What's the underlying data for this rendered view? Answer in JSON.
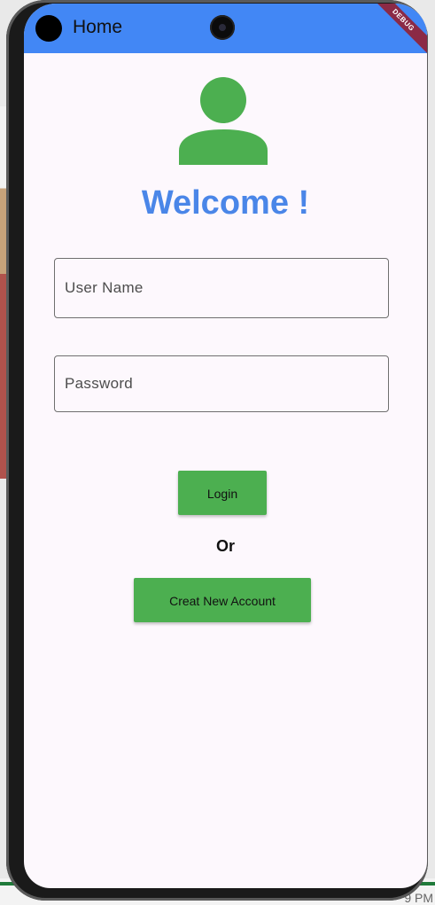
{
  "appbar": {
    "title": "Home",
    "debug_banner": "DEBUG"
  },
  "welcome": "Welcome !",
  "form": {
    "username_placeholder": "User Name",
    "password_placeholder": "Password"
  },
  "buttons": {
    "login": "Login",
    "or": "Or",
    "create_account": "Creat New Account"
  },
  "taskbar_clock": "9 PM",
  "colors": {
    "appbar": "#4287f5",
    "accent_green": "#4caf50",
    "welcome_text": "#4a86e8"
  },
  "icons": {
    "profile": "person-icon"
  }
}
